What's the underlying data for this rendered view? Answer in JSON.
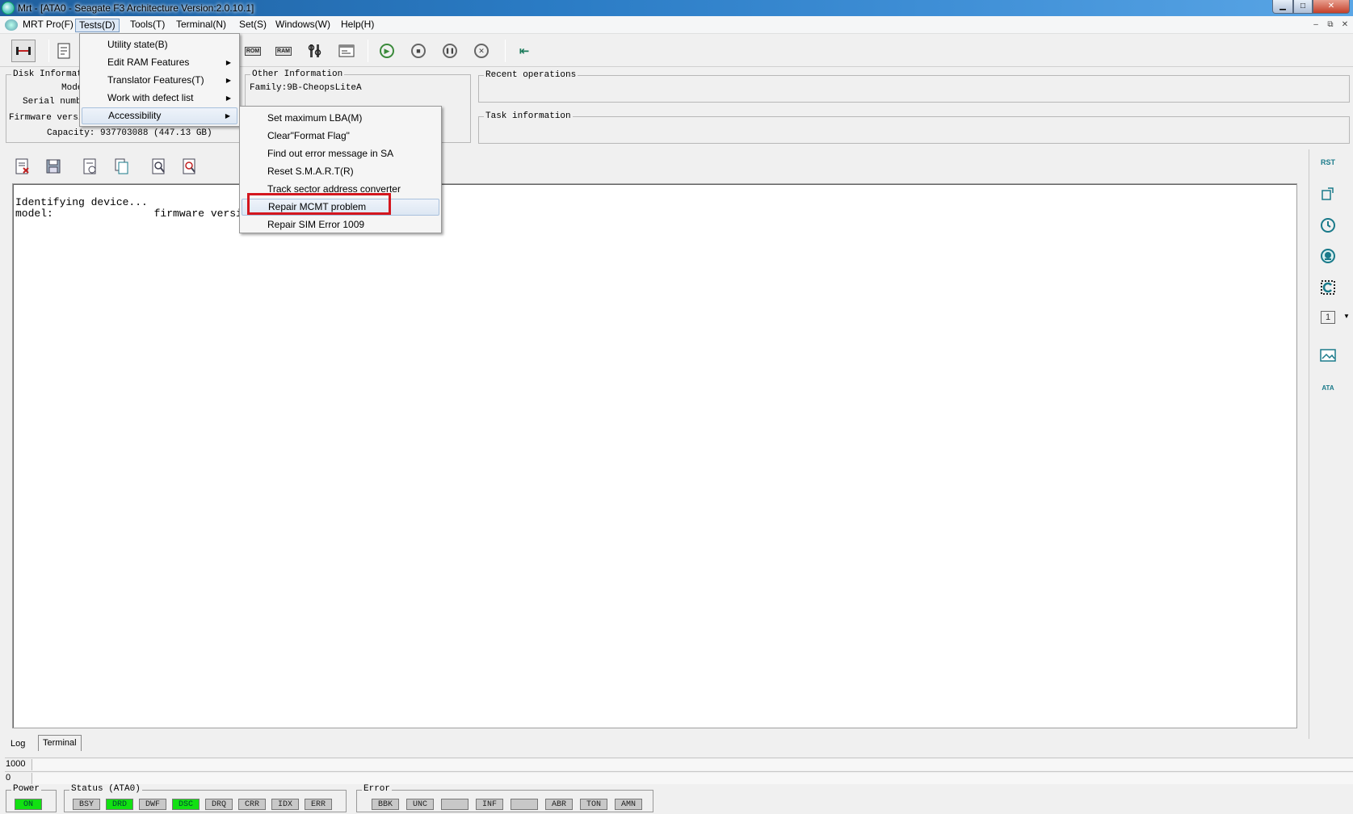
{
  "window": {
    "title": "Mrt - [ATA0 - Seagate F3 Architecture Version:2.0.10.1]",
    "minimize_glyph": "▁",
    "maximize_glyph": "□",
    "close_glyph": "✕"
  },
  "menubar": {
    "items": [
      "MRT Pro(F)",
      "Tests(D)",
      "Tools(T)",
      "Terminal(N)",
      "Set(S)",
      "Windows(W)",
      "Help(H)"
    ],
    "active": "Tests(D)",
    "mdi_min": "–",
    "mdi_restore": "⧉",
    "mdi_close": "✕"
  },
  "toolbar": {
    "rom_label": "ROM",
    "ram_label": "RAM",
    "play_glyph": "▶",
    "stop_glyph": "■",
    "pause_glyph": "❚❚",
    "cancel_glyph": "✕",
    "exit_glyph": "⇤"
  },
  "disk_info": {
    "label": "Disk Informati",
    "model_label": "Mode",
    "serial_label": "Serial numbe",
    "firmware_label": "Firmware versi",
    "capacity_line": "Capacity: 937703088 (447.13 GB)"
  },
  "other_info": {
    "label": "Other Information",
    "family": "Family:9B-CheopsLiteA"
  },
  "recent_ops": {
    "label": "Recent operations"
  },
  "task_info": {
    "label": "Task information"
  },
  "log": {
    "line1": "Identifying device...",
    "line2": "model:                firmware version:                                  "
  },
  "tests_menu": {
    "items": [
      {
        "label": "Utility state(B)",
        "submenu": false
      },
      {
        "label": "Edit RAM Features",
        "submenu": true
      },
      {
        "label": "Translator Features(T)",
        "submenu": true
      },
      {
        "label": "Work with defect list",
        "submenu": true
      },
      {
        "label": "Accessibility",
        "submenu": true
      }
    ],
    "arrow": "▶"
  },
  "accessibility_menu": {
    "items": [
      "Set maximum LBA(M)",
      "Clear\"Format Flag\"",
      "Find out error message in SA",
      "Reset S.M.A.R.T(R)",
      "Track sector address converter",
      "Repair MCMT problem",
      "Repair SIM Error 1009"
    ],
    "highlighted": "Repair MCMT problem"
  },
  "right_bar": {
    "rst_label": "RST",
    "ata_label": "ATA",
    "num_label": "1",
    "dropdown_glyph": "▼"
  },
  "tabs": [
    "Log",
    "Terminal"
  ],
  "progress": {
    "row1": "1000",
    "row2": "0"
  },
  "status": {
    "power": {
      "label": "Power",
      "leds": [
        {
          "text": "ON",
          "on": true
        }
      ]
    },
    "ata": {
      "label": "Status (ATA0)",
      "leds": [
        {
          "text": "BSY",
          "on": false
        },
        {
          "text": "DRD",
          "on": true
        },
        {
          "text": "DWF",
          "on": false
        },
        {
          "text": "DSC",
          "on": true
        },
        {
          "text": "DRQ",
          "on": false
        },
        {
          "text": "CRR",
          "on": false
        },
        {
          "text": "IDX",
          "on": false
        },
        {
          "text": "ERR",
          "on": false
        }
      ]
    },
    "error": {
      "label": "Error",
      "leds": [
        {
          "text": "BBK",
          "on": false
        },
        {
          "text": "UNC",
          "on": false
        },
        {
          "text": "",
          "on": false
        },
        {
          "text": "INF",
          "on": false
        },
        {
          "text": "",
          "on": false
        },
        {
          "text": "ABR",
          "on": false
        },
        {
          "text": "TON",
          "on": false
        },
        {
          "text": "AMN",
          "on": false
        }
      ]
    }
  }
}
